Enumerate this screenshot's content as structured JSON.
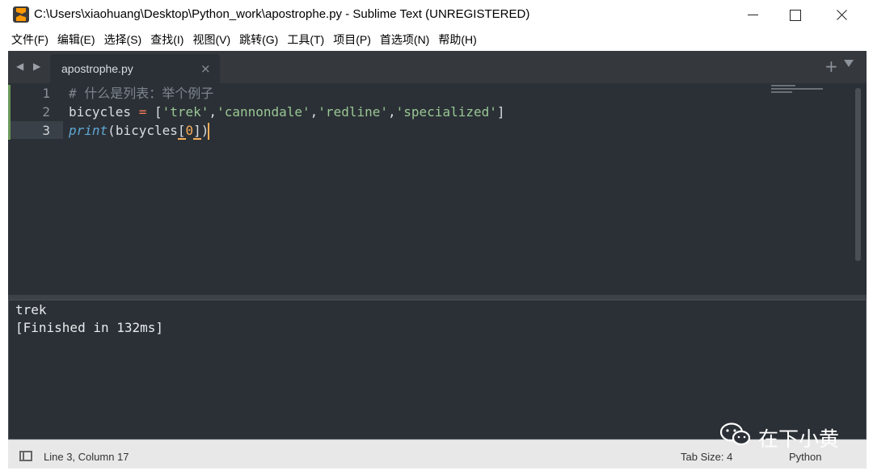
{
  "window": {
    "title": "C:\\Users\\xiaohuang\\Desktop\\Python_work\\apostrophe.py - Sublime Text (UNREGISTERED)"
  },
  "menu": [
    "文件(F)",
    "编辑(E)",
    "选择(S)",
    "查找(I)",
    "视图(V)",
    "跳转(G)",
    "工具(T)",
    "项目(P)",
    "首选项(N)",
    "帮助(H)"
  ],
  "tabs": {
    "nav": "◀ ▶",
    "active_tab": "apostrophe.py",
    "close": "×",
    "new_tab": "+"
  },
  "editor": {
    "line_numbers": [
      "1",
      "2",
      "3"
    ],
    "active_line": 3,
    "code": {
      "line1_comment": "# 什么是列表：举个例子",
      "line2": {
        "var": "bicycles",
        "op": "=",
        "open": "[",
        "s1": "'trek'",
        "s2": "'cannondale'",
        "s3": "'redline'",
        "s4": "'specialized'",
        "close": "]"
      },
      "line3": {
        "fn": "print",
        "arg": "bicycles",
        "index": "0"
      }
    }
  },
  "output": {
    "lines": [
      "trek",
      "[Finished in 132ms]"
    ]
  },
  "status": {
    "position": "Line 3, Column 17",
    "tab_size": "Tab Size: 4",
    "syntax": "Python"
  },
  "watermark": {
    "text": "在下小黄"
  },
  "colors": {
    "editor_bg": "#2b3036",
    "comment": "#7e858c",
    "string": "#99c794",
    "operator": "#f97b58",
    "function": "#5fa8d3",
    "number": "#f9ae58"
  }
}
